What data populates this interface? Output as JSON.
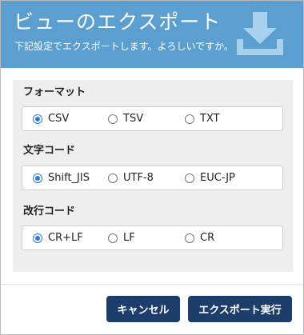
{
  "dialog": {
    "title": "ビューのエクスポート",
    "subtitle": "下記設定でエクスポートします。よろしいですか。",
    "header_icon": "download-icon",
    "colors": {
      "header": "#5b9fd1",
      "button": "#1d3d6b",
      "radio_checked": "#2a7ae2"
    }
  },
  "sections": [
    {
      "label": "フォーマット",
      "selected": "CSV",
      "options": [
        "CSV",
        "TSV",
        "TXT"
      ]
    },
    {
      "label": "文字コード",
      "selected": "Shift_JIS",
      "options": [
        "Shift_JIS",
        "UTF-8",
        "EUC-JP"
      ]
    },
    {
      "label": "改行コード",
      "selected": "CR+LF",
      "options": [
        "CR+LF",
        "LF",
        "CR"
      ]
    }
  ],
  "buttons": {
    "cancel": "キャンセル",
    "export": "エクスポート実行"
  }
}
